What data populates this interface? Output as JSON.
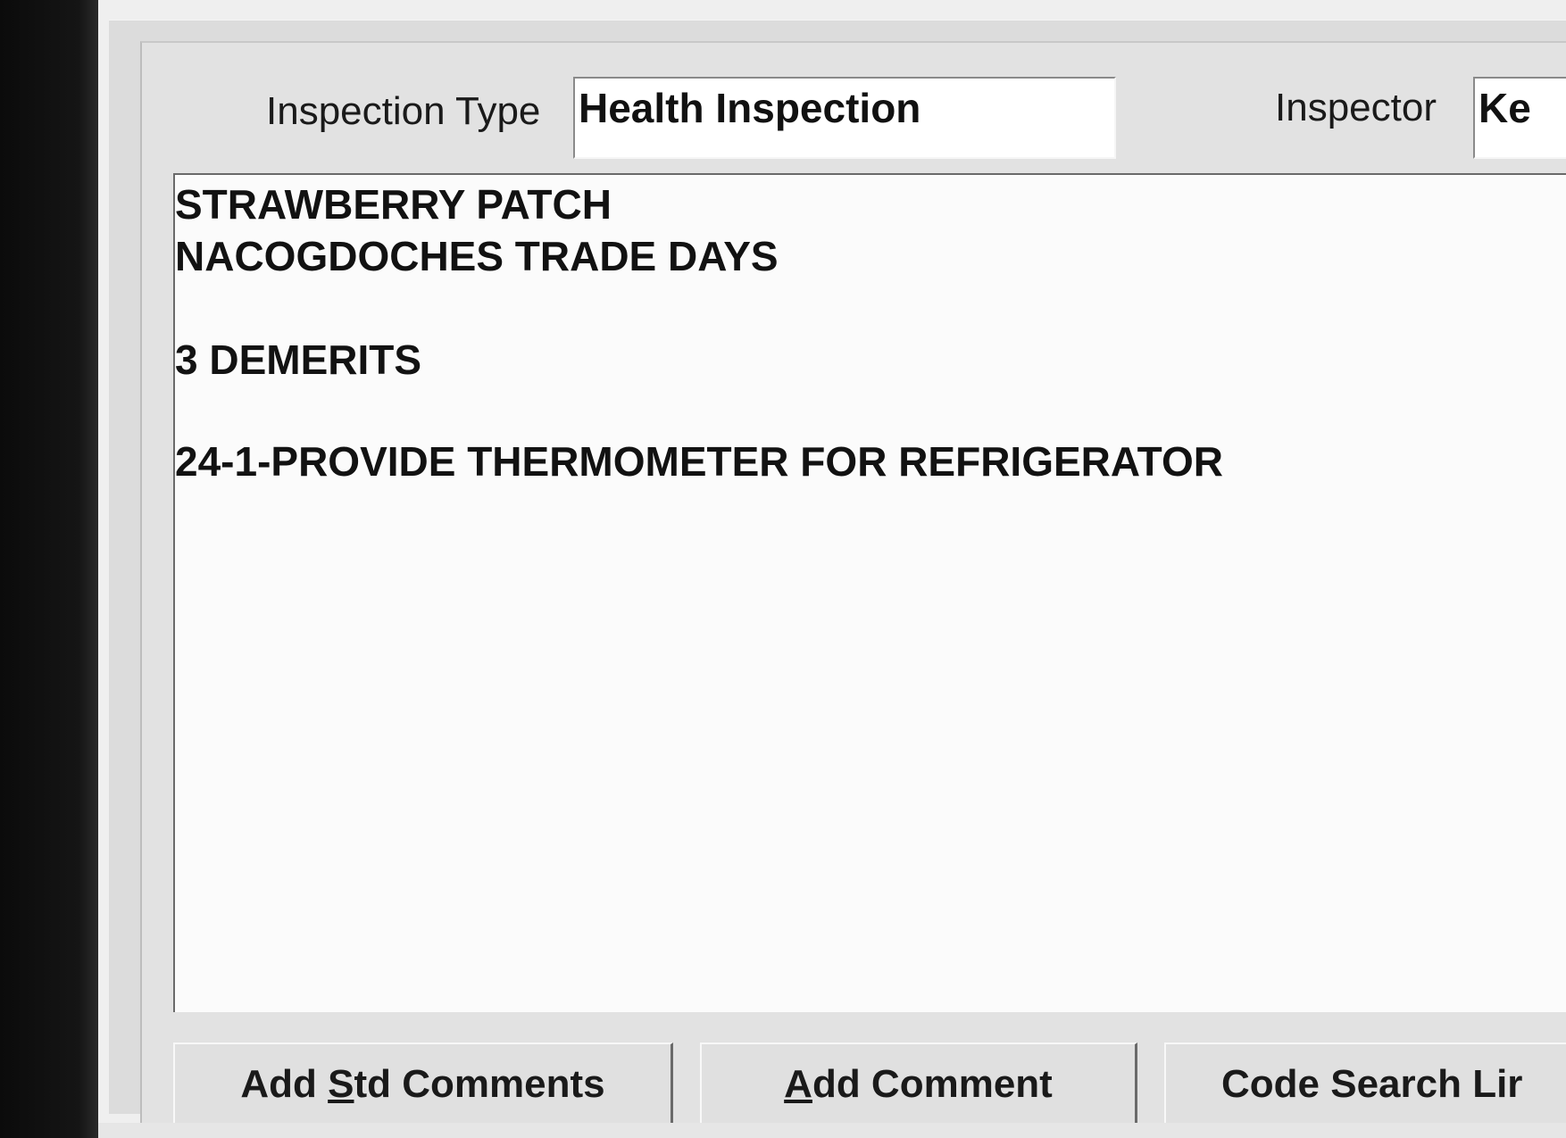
{
  "form": {
    "inspection_type_label": "Inspection Type",
    "inspection_type_value": "Health Inspection",
    "inspector_label": "Inspector",
    "inspector_value": "Ke"
  },
  "comments": {
    "lines": [
      "STRAWBERRY PATCH",
      "NACOGDOCHES TRADE DAYS",
      "",
      "3 DEMERITS",
      "",
      "24-1-PROVIDE THERMOMETER FOR REFRIGERATOR"
    ],
    "line_1": "STRAWBERRY PATCH",
    "line_2": "NACOGDOCHES TRADE DAYS",
    "line_3": "3 DEMERITS",
    "line_4": "24-1-PROVIDE THERMOMETER FOR REFRIGERATOR"
  },
  "buttons": {
    "add_std_comments": {
      "before": "Add ",
      "mnemonic": "S",
      "after": "td Comments"
    },
    "add_comment": {
      "before": "",
      "mnemonic": "A",
      "after": "dd Comment"
    },
    "code_search": {
      "label": "Code Search Lir"
    }
  }
}
